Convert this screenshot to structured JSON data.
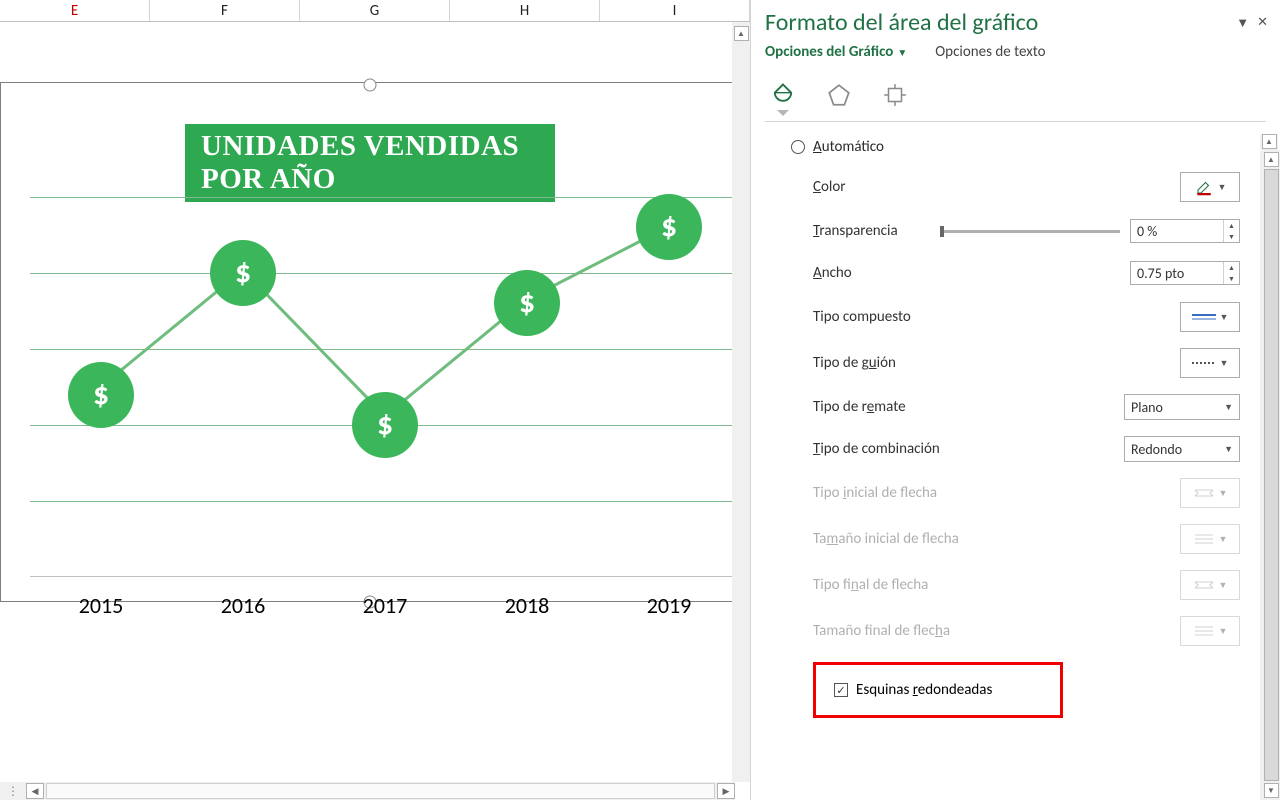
{
  "columns": [
    "E",
    "F",
    "G",
    "H",
    "I"
  ],
  "chart_data": {
    "type": "line",
    "title": "UNIDADES VENDIDAS POR AÑO",
    "categories": [
      "2015",
      "2016",
      "2017",
      "2018",
      "2019"
    ],
    "values": [
      120,
      200,
      100,
      180,
      230
    ],
    "ylim": [
      0,
      250
    ],
    "grid": true,
    "marker": "dollar-circle"
  },
  "pane": {
    "title": "Formato del área del gráfico",
    "opt_chart": "Opciones del Gráfico",
    "opt_text": "Opciones de texto",
    "auto": "Automático",
    "props": {
      "color": "Color",
      "transparency": "Transparencia",
      "transparency_val": "0 %",
      "width": "Ancho",
      "width_val": "0.75 pto",
      "compound": "Tipo compuesto",
      "dash": "Tipo de guión",
      "cap": "Tipo de remate",
      "cap_val": "Plano",
      "join": "Tipo de combinación",
      "join_val": "Redondo",
      "arrow_begin_type": "Tipo inicial de flecha",
      "arrow_begin_size": "Tamaño inicial de flecha",
      "arrow_end_type": "Tipo final de flecha",
      "arrow_end_size": "Tamaño final de flecha",
      "rounded": "Esquinas redondeadas"
    }
  }
}
